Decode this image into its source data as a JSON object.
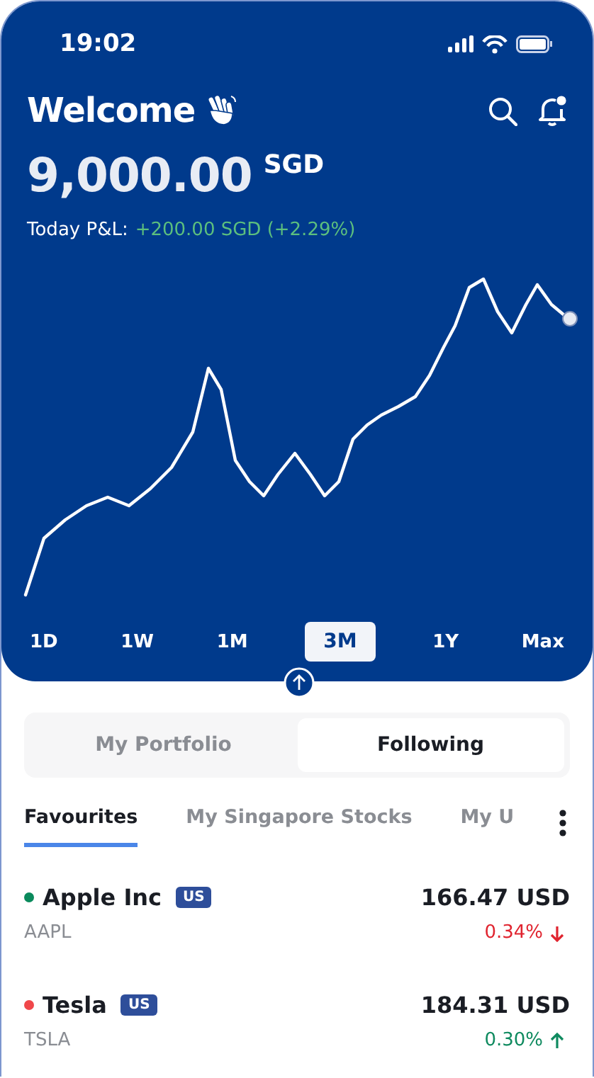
{
  "status_bar": {
    "time": "19:02"
  },
  "header": {
    "title": "Welcome",
    "balance": "9,000.00",
    "currency": "SGD",
    "pnl_label": "Today P&L:",
    "pnl_value": "+200.00 SGD (+2.29%)"
  },
  "ranges": [
    {
      "label": "1D",
      "selected": false
    },
    {
      "label": "1W",
      "selected": false
    },
    {
      "label": "1M",
      "selected": false
    },
    {
      "label": "3M",
      "selected": true
    },
    {
      "label": "1Y",
      "selected": false
    },
    {
      "label": "Max",
      "selected": false
    }
  ],
  "segments": [
    {
      "label": "My Portfolio",
      "selected": false
    },
    {
      "label": "Following",
      "selected": true
    }
  ],
  "lists": [
    {
      "label": "Favourites",
      "selected": true
    },
    {
      "label": "My Singapore Stocks",
      "selected": false
    },
    {
      "label": "My U",
      "selected": false
    }
  ],
  "stocks": [
    {
      "name": "Apple Inc",
      "market": "US",
      "ticker": "AAPL",
      "price": "166.47 USD",
      "change": "0.34%",
      "kind": "down",
      "color": "#0a8a5c"
    },
    {
      "name": "Tesla",
      "market": "US",
      "ticker": "TSLA",
      "price": "184.31 USD",
      "change": "0.30%",
      "kind": "up",
      "color": "#f0474a"
    }
  ]
}
